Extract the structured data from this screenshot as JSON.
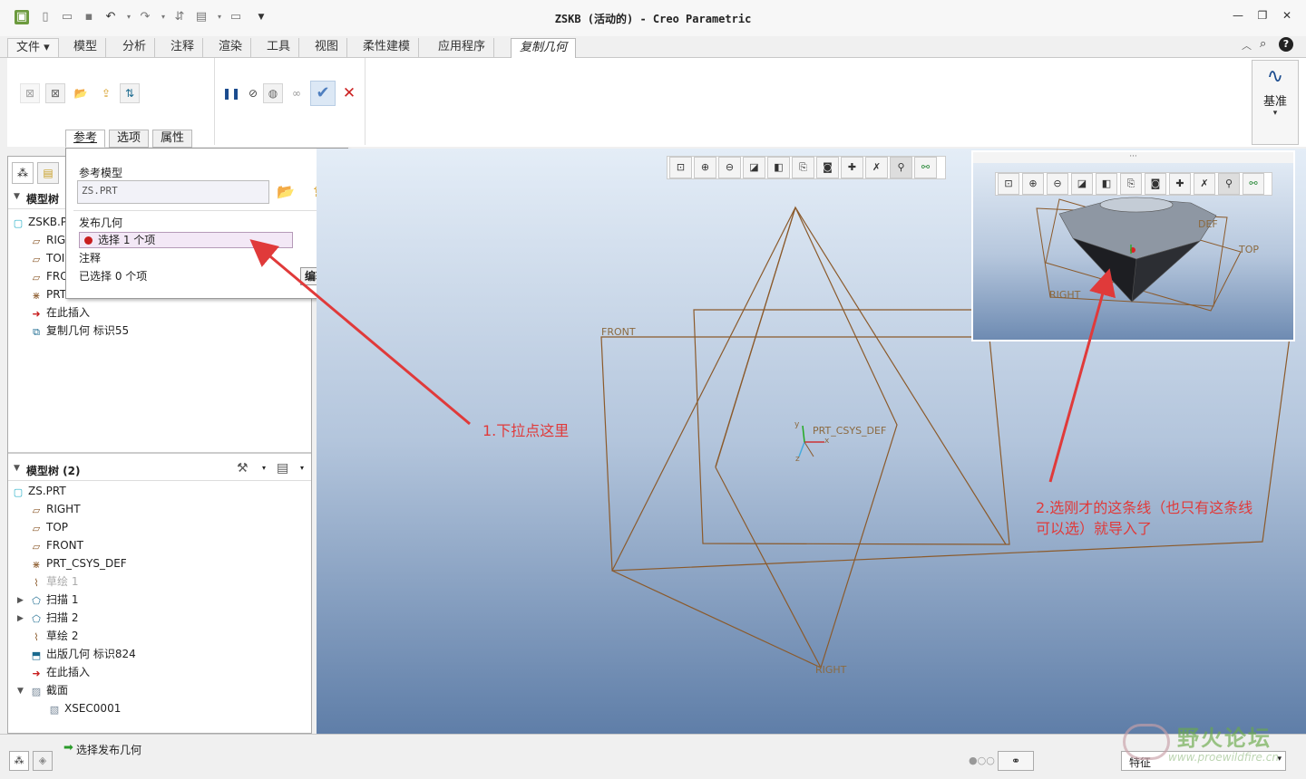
{
  "app": {
    "title": "ZSKB (活动的) - Creo Parametric"
  },
  "menu": {
    "tabs": [
      "文件 ▾",
      "模型",
      "分析",
      "注释",
      "渲染",
      "工具",
      "视图",
      "柔性建模",
      "应用程序",
      "复制几何"
    ],
    "active_tab": "复制几何"
  },
  "ribbon": {
    "subtabs": [
      "参考",
      "选项",
      "属性"
    ],
    "datum_label": "基准",
    "datum_arrow": "▾"
  },
  "ref_popup": {
    "ref_model_label": "参考模型",
    "ref_model_value": "ZS.PRT",
    "publish_geom_label": "发布几何",
    "select_item": "选择 1 个项",
    "note_label": "注释",
    "selected_count": "已选择 0 个项",
    "edit_button": "编辑"
  },
  "tree_top": {
    "items": [
      {
        "label": "ZSKB.P",
        "icon": "part-icon"
      },
      {
        "label": "RIG",
        "icon": "datum-plane-icon"
      },
      {
        "label": "TOI",
        "icon": "datum-plane-icon"
      },
      {
        "label": "FRO",
        "icon": "datum-plane-icon"
      },
      {
        "label": "PRT",
        "icon": "csys-icon"
      },
      {
        "label": "在此插入",
        "icon": "insert-arrow-icon"
      },
      {
        "label": "复制几何 标识55",
        "icon": "copy-geom-icon"
      }
    ]
  },
  "tree_bottom": {
    "header": "模型树 (2)",
    "items": [
      {
        "label": "ZS.PRT",
        "icon": "part-icon",
        "expander": ""
      },
      {
        "label": "RIGHT",
        "icon": "datum-plane-icon",
        "expander": ""
      },
      {
        "label": "TOP",
        "icon": "datum-plane-icon",
        "expander": ""
      },
      {
        "label": "FRONT",
        "icon": "datum-plane-icon",
        "expander": ""
      },
      {
        "label": "PRT_CSYS_DEF",
        "icon": "csys-icon",
        "expander": ""
      },
      {
        "label": "草绘 1",
        "icon": "sketch-icon",
        "expander": ""
      },
      {
        "label": "扫描 1",
        "icon": "sweep-icon",
        "expander": "▶"
      },
      {
        "label": "扫描 2",
        "icon": "sweep-icon",
        "expander": "▶"
      },
      {
        "label": "草绘 2",
        "icon": "sketch-icon",
        "expander": ""
      },
      {
        "label": "出版几何 标识824",
        "icon": "publish-geom-icon",
        "expander": ""
      },
      {
        "label": "在此插入",
        "icon": "insert-arrow-icon",
        "expander": ""
      },
      {
        "label": "截面",
        "icon": "section-icon",
        "expander": "▼"
      },
      {
        "label": "XSEC0001",
        "icon": "xsec-icon",
        "expander": ""
      }
    ]
  },
  "tree_header_top": "模型树",
  "viewport": {
    "front_label": "FRONT",
    "right_label": "RIGHT",
    "csys_label": "PRT_CSYS_DEF",
    "axis_x": "x",
    "axis_y": "y",
    "axis_z": "z"
  },
  "inset": {
    "labels": [
      "DEF",
      "TOP",
      "RIGHT"
    ],
    "dots": "···"
  },
  "annotations": {
    "step1": "1.下拉点这里",
    "step2_line1": "2.选刚才的这条线（也只有这条线",
    "step2_line2": "可以选）就导入了"
  },
  "status": {
    "message": "选择发布几何",
    "filter": "特征",
    "watermark_title": "野火论坛",
    "watermark_url": "www.proewildfire.cn"
  },
  "colors": {
    "annotation": "#e03a3a",
    "datum": "#8b6a40",
    "accent_check": "#4f7fbf",
    "cancel": "#cc2222"
  }
}
